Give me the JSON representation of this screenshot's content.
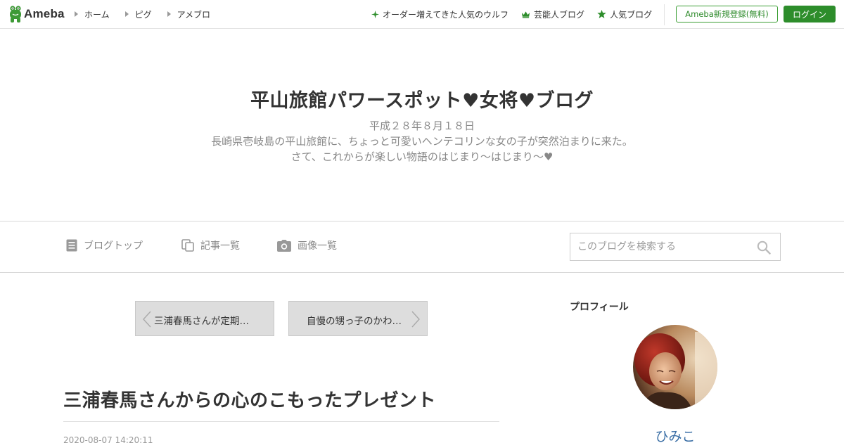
{
  "global_header": {
    "logo_text": "Ameba",
    "nav": [
      {
        "label": "ホーム"
      },
      {
        "label": "ピグ"
      },
      {
        "label": "アメブロ"
      }
    ],
    "promo": [
      {
        "label": "オーダー増えてきた人気のウルフ",
        "icon": "sparkle-icon"
      },
      {
        "label": "芸能人ブログ",
        "icon": "crown-icon"
      },
      {
        "label": "人気ブログ",
        "icon": "star-icon"
      }
    ],
    "register_label": "Ameba新規登録(無料)",
    "login_label": "ログイン",
    "accent_color": "#2d8d2b"
  },
  "blog": {
    "title": "平山旅館パワースポット♥女将♥ブログ",
    "description_lines": [
      "平成２８年８月１８日",
      "長崎県壱岐島の平山旅館に、ちょっと可愛いヘンテコリンな女の子が突然泊まりに来た。",
      "さて、これからが楽しい物語のはじまり～はじまり～♥"
    ]
  },
  "blog_nav": {
    "items": [
      {
        "label": "ブログトップ",
        "icon": "document-icon"
      },
      {
        "label": "記事一覧",
        "icon": "copy-icon"
      },
      {
        "label": "画像一覧",
        "icon": "camera-icon"
      }
    ],
    "search_placeholder": "このブログを検索する"
  },
  "pager": {
    "prev_label": "三浦春馬さんが定期…",
    "next_label": "自慢の甥っ子のかわ…"
  },
  "entry": {
    "title": "三浦春馬さんからの心のこもったプレゼント",
    "date": "2020-08-07 14:20:11"
  },
  "sidebar": {
    "profile_title": "プロフィール",
    "profile_name": "ひみこ"
  }
}
